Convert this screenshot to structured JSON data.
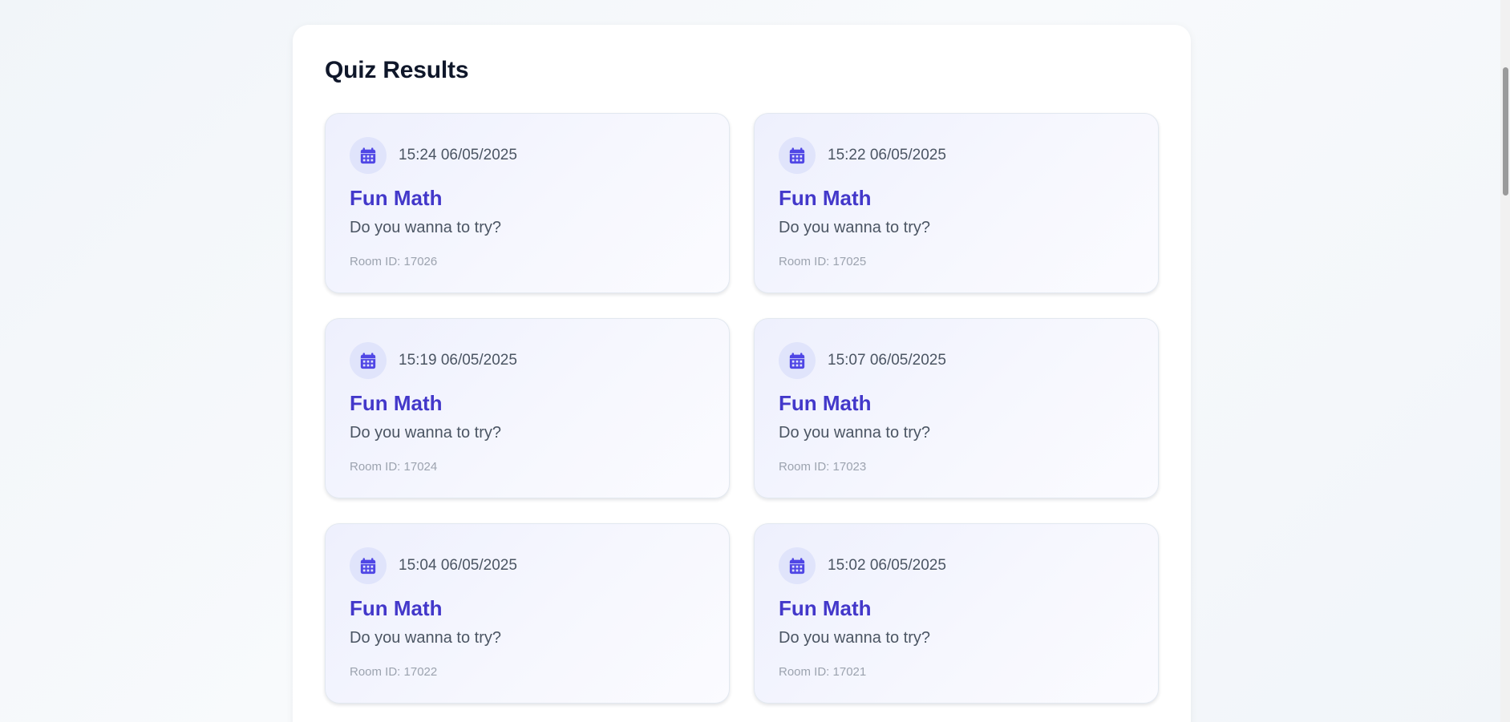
{
  "page": {
    "title": "Quiz Results"
  },
  "colors": {
    "accent": "#4338ca",
    "icon_bg": "#e0e4fb",
    "card_bg": "#eef0fd"
  },
  "icon": "calendar-icon",
  "cards": [
    {
      "datetime": "15:24 06/05/2025",
      "title": "Fun Math",
      "description": "Do you wanna to try?",
      "room": "Room ID: 17026"
    },
    {
      "datetime": "15:22 06/05/2025",
      "title": "Fun Math",
      "description": "Do you wanna to try?",
      "room": "Room ID: 17025"
    },
    {
      "datetime": "15:19 06/05/2025",
      "title": "Fun Math",
      "description": "Do you wanna to try?",
      "room": "Room ID: 17024"
    },
    {
      "datetime": "15:07 06/05/2025",
      "title": "Fun Math",
      "description": "Do you wanna to try?",
      "room": "Room ID: 17023"
    },
    {
      "datetime": "15:04 06/05/2025",
      "title": "Fun Math",
      "description": "Do you wanna to try?",
      "room": "Room ID: 17022"
    },
    {
      "datetime": "15:02 06/05/2025",
      "title": "Fun Math",
      "description": "Do you wanna to try?",
      "room": "Room ID: 17021"
    }
  ]
}
